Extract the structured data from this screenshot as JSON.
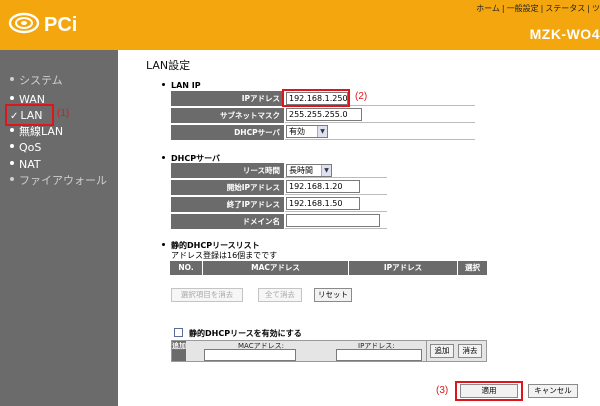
{
  "header": {
    "nav": [
      "ホーム",
      "一般設定",
      "ステータス",
      "ツ"
    ],
    "model": "MZK-WO4",
    "logo_text": "PCi"
  },
  "sidebar": {
    "items": [
      {
        "label": "システム",
        "state": "disabled"
      },
      {
        "label": "WAN",
        "state": "normal"
      },
      {
        "label": "LAN",
        "state": "active"
      },
      {
        "label": "無線LAN",
        "state": "normal"
      },
      {
        "label": "QoS",
        "state": "normal"
      },
      {
        "label": "NAT",
        "state": "normal"
      },
      {
        "label": "ファイアウォール",
        "state": "disabled"
      }
    ],
    "lan_callout": "(1)"
  },
  "main": {
    "title": "LAN設定",
    "lan_ip": {
      "section_title": "LAN IP",
      "ip_label": "IPアドレス",
      "ip_value": "192.168.1.250",
      "ip_callout": "(2)",
      "subnet_label": "サブネットマスク",
      "subnet_value": "255.255.255.0",
      "dhcp_label": "DHCPサーバ",
      "dhcp_value": "有効"
    },
    "dhcp": {
      "section_title": "DHCPサーバ",
      "lease_label": "リース時間",
      "lease_value": "長時間",
      "start_label": "開始IPアドレス",
      "start_value": "192.168.1.20",
      "end_label": "終了IPアドレス",
      "end_value": "192.168.1.50",
      "domain_label": "ドメイン名",
      "domain_value": ""
    },
    "static": {
      "section_title": "静的DHCPリースリスト",
      "note": "アドレス登録は16個までです",
      "columns": [
        "NO.",
        "MACアドレス",
        "IPアドレス",
        "選択"
      ],
      "btn_clear_selected": "選択項目を消去",
      "btn_clear_all": "全て消去",
      "btn_reset": "リセット"
    },
    "enable": {
      "checkbox_label": "静的DHCPリースを有効にする",
      "add_label": "追加",
      "mac_label": "MACアドレス:",
      "ip_label": "IPアドレス:",
      "btn_add": "追加",
      "btn_delete": "消去"
    },
    "footer": {
      "apply_callout": "(3)",
      "btn_apply": "適用",
      "btn_cancel": "キャンセル"
    }
  },
  "colors": {
    "header": "#f3a60e",
    "sidebar": "#6b6b6b",
    "highlight": "#e0151b"
  }
}
